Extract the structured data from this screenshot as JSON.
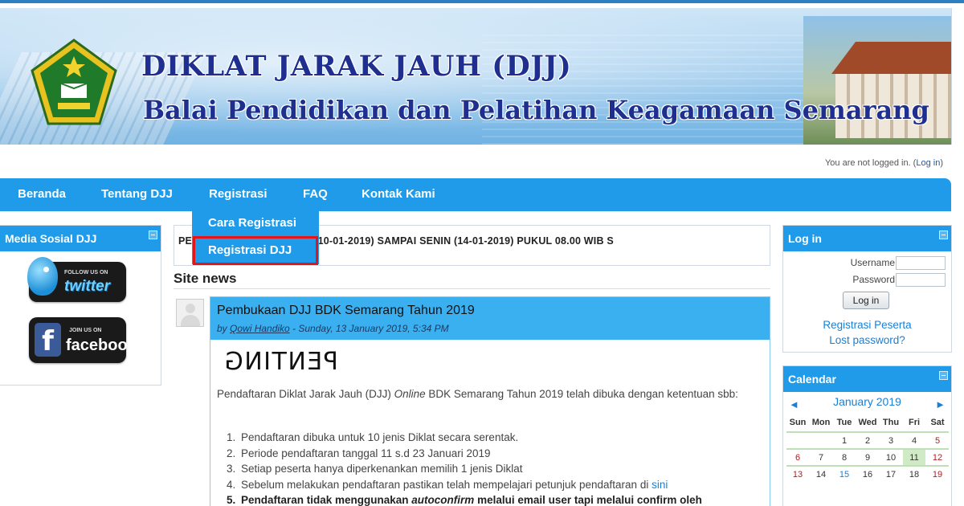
{
  "header": {
    "title": "DIKLAT JARAK JAUH (DJJ)",
    "subtitle": "Balai Pendidikan dan Pelatihan Keagamaan Semarang",
    "logo_icon": "kementerian-agama-logo"
  },
  "login_status": {
    "text": "You are not logged in. (",
    "link": "Log in",
    "suffix": ")"
  },
  "nav": {
    "items": [
      "Beranda",
      "Tentang DJJ",
      "Registrasi",
      "FAQ",
      "Kontak Kami"
    ],
    "dropdown": [
      "Cara Registrasi",
      "Registrasi DJJ"
    ],
    "highlight_color": "#e2151b",
    "accent_color": "#1f9be9"
  },
  "social": {
    "title": "Media Sosial DJJ",
    "twitter_small": "FOLLOW US ON",
    "twitter_big": "twitter",
    "facebook_small": "JOIN US ON",
    "facebook_big": "facebook"
  },
  "marquee": {
    "text": "PE                    DAFTAR SEJAK JUMAT (10-01-2019) SAMPAI SENIN (14-01-2019) PUKUL 08.00 WIB S"
  },
  "news": {
    "heading": "Site news",
    "post": {
      "title": "Pembukaan DJJ BDK Semarang Tahun 2019",
      "by_prefix": "by ",
      "author": "Qowi Handiko",
      "date": " - Sunday, 13 January 2019, 5:34 PM",
      "banner_word": "PENTING",
      "intro_a": "Pendaftaran Diklat Jarak Jauh (DJJ) ",
      "intro_online": "Online",
      "intro_b": " BDK Semarang Tahun 2019 telah dibuka dengan ketentuan sbb:",
      "items": [
        "Pendaftaran dibuka untuk 10 jenis Diklat secara serentak.",
        "Periode pendaftaran tanggal 11 s.d 23 Januari 2019",
        "Setiap peserta hanya diperkenankan memilih 1 jenis Diklat",
        "Sebelum melakukan pendaftaran pastikan telah mempelajari petunjuk pendaftaran di "
      ],
      "item4_link": "sini",
      "item5_a": "Pendaftaran tidak menggunakan ",
      "item5_b": "autoconfirm",
      "item5_c": " melalui email user tapi melalui confirm oleh"
    }
  },
  "login_block": {
    "title": "Log in",
    "username_label": "Username",
    "password_label": "Password",
    "button": "Log in",
    "register_link": "Registrasi Peserta",
    "lost_password": "Lost password?"
  },
  "calendar": {
    "title": "Calendar",
    "month": "January 2019",
    "prev": "◄",
    "next": "►",
    "days": [
      "Sun",
      "Mon",
      "Tue",
      "Wed",
      "Thu",
      "Fri",
      "Sat"
    ],
    "week1": [
      "",
      "",
      "1",
      "2",
      "3",
      "4",
      "5"
    ],
    "week2": [
      "6",
      "7",
      "8",
      "9",
      "10",
      "11",
      "12"
    ],
    "week3": [
      "13",
      "14",
      "15",
      "16",
      "17",
      "18",
      "19"
    ]
  }
}
